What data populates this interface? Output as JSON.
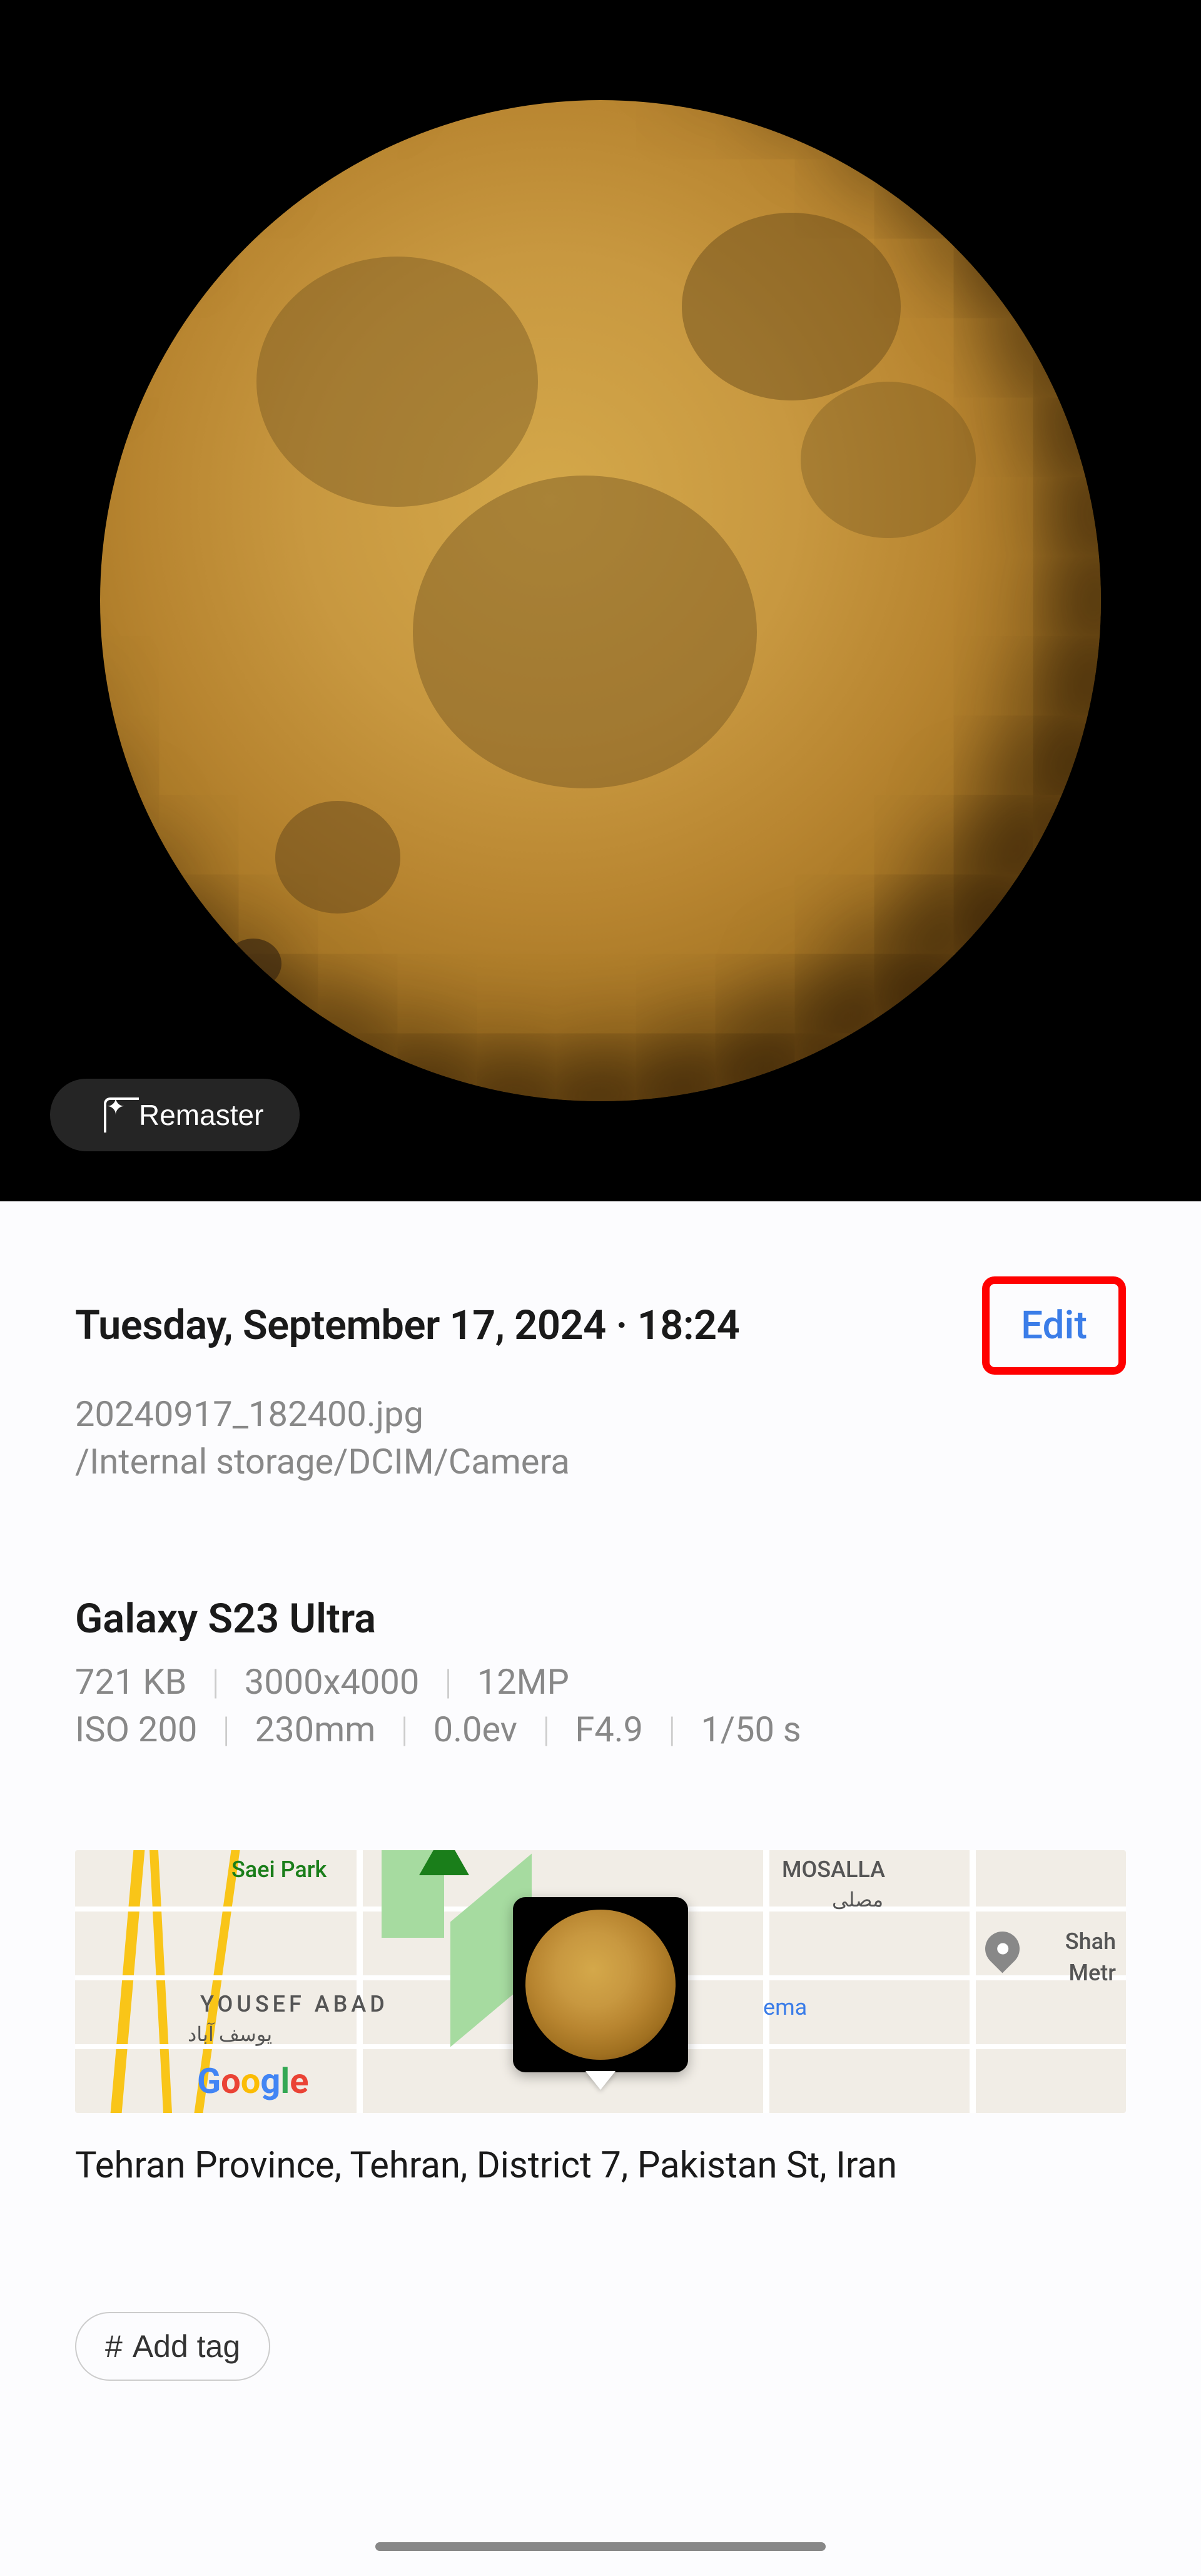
{
  "buttons": {
    "remaster": "Remaster",
    "edit": "Edit",
    "addTag": "Add tag"
  },
  "photo": {
    "datetime": "Tuesday, September 17, 2024 · 18:24",
    "filename": "20240917_182400.jpg",
    "filepath": "/Internal storage/DCIM/Camera"
  },
  "device": {
    "name": "Galaxy S23 Ultra",
    "fileSize": "721 KB",
    "resolution": "3000x4000",
    "megapixels": "12MP",
    "iso": "ISO 200",
    "focalLength": "230mm",
    "ev": "0.0ev",
    "aperture": "F4.9",
    "shutter": "1/50 s"
  },
  "location": {
    "address": "Tehran Province, Tehran, District 7, Pakistan St, Iran",
    "labels": {
      "saeiPark": "Saei Park",
      "mosalla": "MOSALLA",
      "mosallaAr": "مصلی",
      "yousefAbad": "YOUSEF ABAD",
      "yousefAbadAr": "یوسف آباد",
      "ema": "ema",
      "shah": "Shah",
      "metr": "Metr"
    }
  }
}
